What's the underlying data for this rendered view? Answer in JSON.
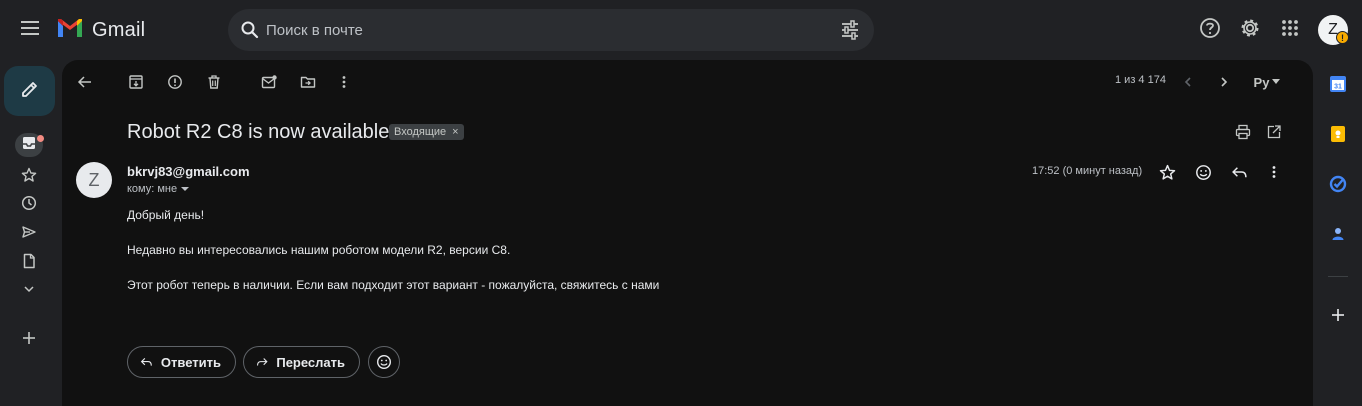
{
  "app": {
    "name": "Gmail",
    "search_placeholder": "Поиск в почте",
    "avatar_letter": "Z",
    "avatar_badge": "!"
  },
  "toolbar": {
    "pager": "1 из 4 174",
    "lang": "Ру"
  },
  "email": {
    "subject": "Robot R2 C8 is now available",
    "label": "Входящие",
    "label_close": "×",
    "sender_initial": "Z",
    "sender": "bkrvj83@gmail.com",
    "to": "кому: мне",
    "time": "17:52 (0 минут назад)",
    "body": [
      "Добрый день!",
      "Недавно вы интересовались нашим роботом модели R2, версии C8.",
      "Этот робот теперь в наличии. Если вам подходит этот вариант - пожалуйста, свяжитесь с нами"
    ],
    "reply_label": "Ответить",
    "forward_label": "Переслать"
  },
  "colors": {
    "background": "#202124",
    "panel": "#111111",
    "compose": "#1e3a45",
    "badge": "#f9ab00",
    "notification_dot": "#f28b82"
  }
}
